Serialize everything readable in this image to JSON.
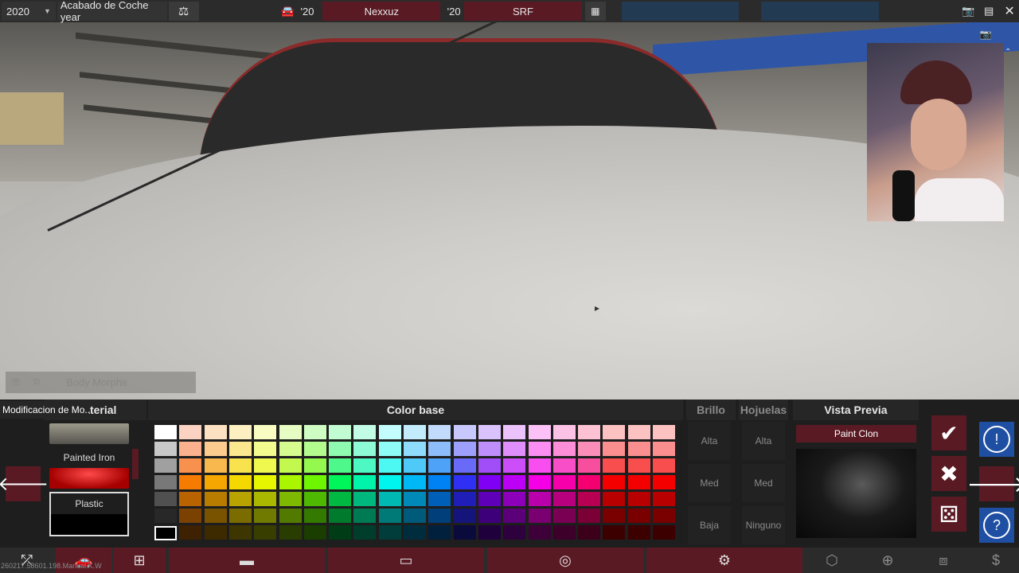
{
  "topbar": {
    "year": "2020",
    "title": "Acabado de Coche year",
    "model_year": "'20",
    "maker": "Nexxuz",
    "engine_year": "'20",
    "model": "SRF",
    "icons": [
      "balance-icon",
      "car-icon",
      "layout-icon",
      "camera-icon",
      "menu-icon",
      "close-icon"
    ]
  },
  "viewport": {
    "body_morphs_label": "Body Morphs"
  },
  "panel": {
    "mod_tab_label": "Modificacion de Mo...",
    "material_header": "Material",
    "color_header": "Color base",
    "brillo_header": "Brillo",
    "hojuelas_header": "Hojuelas",
    "preview_header": "Vista Previa",
    "materials": [
      {
        "label": ""
      },
      {
        "label": "Painted Iron"
      },
      {
        "label": "Plastic"
      }
    ],
    "selected_material": "Plastic",
    "brillo_options": [
      "Alta",
      "Med",
      "Baja"
    ],
    "hojuelas_options": [
      "Alta",
      "Med",
      "Ninguno"
    ],
    "paint_clone_label": "Paint Clon",
    "action_icons": [
      "checkmark-icon",
      "x-icon",
      "random-dice-icon",
      "warning-icon",
      "forward-arrow-icon",
      "help-icon"
    ]
  },
  "palette": {
    "selected_color": "#000000",
    "grays": [
      "#ffffff",
      "#c8c8c8",
      "#a0a0a0",
      "#787878",
      "#505050",
      "#282828",
      "#000000"
    ],
    "hues": [
      [
        "#fcd2c2",
        "#fce0c2",
        "#fcf0c2",
        "#f8fcc2",
        "#e6fcc2",
        "#cffcc2",
        "#c2fcd2",
        "#c2fce6",
        "#c2fcfc",
        "#c2ecfc",
        "#c2dafc",
        "#c8c8fc",
        "#dac2fc",
        "#ecc2fc",
        "#fcc2f8",
        "#fcc2e6",
        "#fcc2d4",
        "#fcc2c2"
      ],
      [
        "#fbb08e",
        "#fbcc8e",
        "#fbe78e",
        "#f3fb8e",
        "#d6fb8e",
        "#b3fb8e",
        "#8efbb0",
        "#8efbd6",
        "#8efbf7",
        "#8edbfb",
        "#8ebdfb",
        "#9e9efb",
        "#be8efb",
        "#df8efb",
        "#fb8ef3",
        "#fb8ed7",
        "#fb8eb9",
        "#fb8e8e"
      ],
      [
        "#f8904e",
        "#f8b84e",
        "#f8e24e",
        "#eef84e",
        "#c3f84e",
        "#94f84e",
        "#4ef88a",
        "#4ef8c3",
        "#4ef8f2",
        "#4ec9f8",
        "#4ea2f8",
        "#6a6af8",
        "#a14ef8",
        "#cc4ef8",
        "#f84ef0",
        "#f84ec7",
        "#f84e9e",
        "#f84e4e"
      ],
      [
        "#f57c00",
        "#f5a600",
        "#f5d800",
        "#e6f500",
        "#aaf500",
        "#6ef500",
        "#00f55a",
        "#00f5aa",
        "#00f5ef",
        "#00b8f5",
        "#0082f5",
        "#3030f5",
        "#8000f5",
        "#bb00f5",
        "#f500e6",
        "#f500aa",
        "#f50070",
        "#f50000"
      ],
      [
        "#b86200",
        "#b87d00",
        "#b8a300",
        "#abb800",
        "#7eb800",
        "#4fb800",
        "#00b842",
        "#00b87e",
        "#00b8b3",
        "#0089b8",
        "#005fb8",
        "#1f1fb8",
        "#5e00b8",
        "#8b00b8",
        "#b800ab",
        "#b8007e",
        "#b80052",
        "#b80000"
      ],
      [
        "#7a4100",
        "#7a5300",
        "#7a6c00",
        "#717a00",
        "#537a00",
        "#347a00",
        "#007a2c",
        "#007a53",
        "#007a77",
        "#005b7a",
        "#003f7a",
        "#14147a",
        "#3e007a",
        "#5c007a",
        "#7a0071",
        "#7a0053",
        "#7a0036",
        "#7a0000"
      ],
      [
        "#3d2100",
        "#3d2a00",
        "#3d3600",
        "#383d00",
        "#2a3d00",
        "#1a3d00",
        "#003d16",
        "#003d2a",
        "#003d3b",
        "#002d3d",
        "#00203d",
        "#0a0a3d",
        "#1f003d",
        "#2e003d",
        "#3d0038",
        "#3d002a",
        "#3d001b",
        "#3d0000"
      ]
    ]
  },
  "bottomnav": {
    "version": "260217.58601.198.Manual.K.W",
    "icons": [
      "move-icon",
      "car-body-icon",
      "trim-icon",
      "chassis-icon",
      "engine-icon",
      "turbo-icon",
      "fuel-icon",
      "gearbox-icon",
      "suspension-icon",
      "interior-icon",
      "stats-icon"
    ]
  }
}
